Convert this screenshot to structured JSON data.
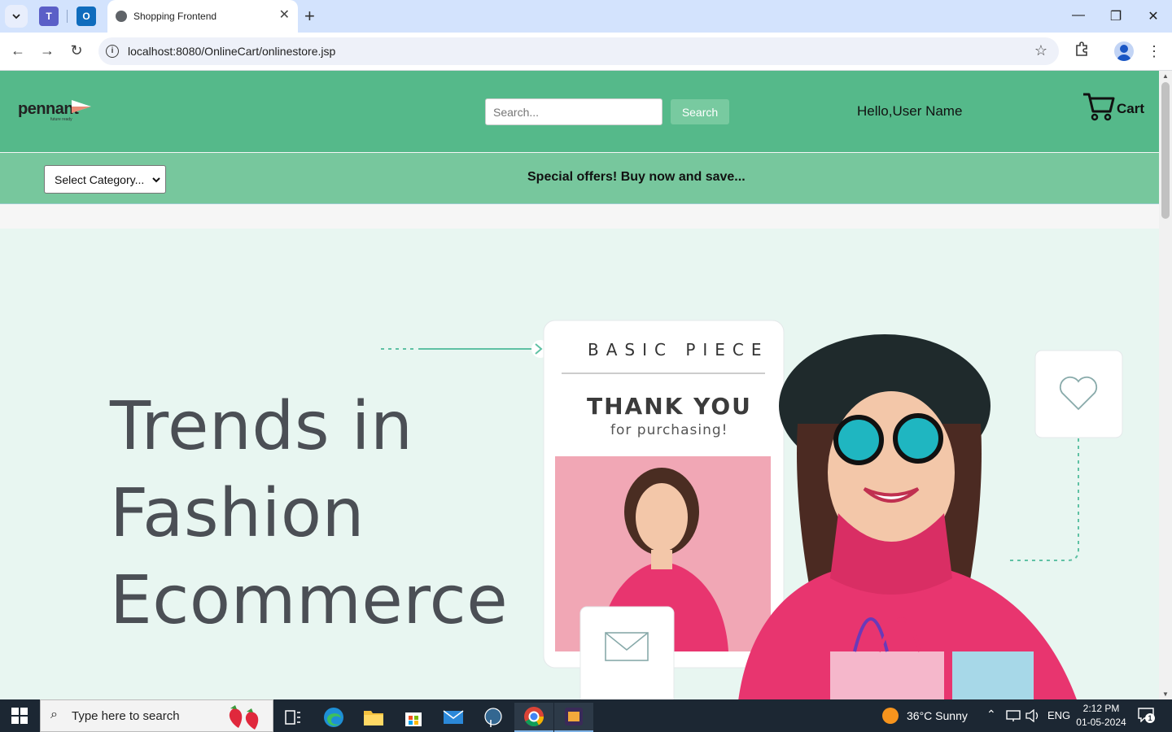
{
  "browser": {
    "tab_title": "Shopping Frontend",
    "url": "localhost:8080/OnlineCart/onlinestore.jsp"
  },
  "header": {
    "logo_text": "pennant",
    "logo_tagline": "future ready",
    "search_placeholder": "Search...",
    "search_button": "Search",
    "greeting": "Hello,User Name",
    "cart_label": "Cart"
  },
  "offer_bar": {
    "category_select": "Select Category...",
    "offer_text": "Special offers! Buy now and save..."
  },
  "hero": {
    "headline_lines": [
      "Trends in",
      "Fashion",
      "Ecommerce"
    ],
    "card_brand": "BASIC PIECE",
    "card_title": "THANK YOU",
    "card_subtitle": "for purchasing!"
  },
  "taskbar": {
    "search_text": "Type here to search",
    "weather": "36°C  Sunny",
    "language": "ENG",
    "time": "2:12 PM",
    "date": "01-05-2024",
    "notification_count": "1"
  },
  "colors": {
    "header_bg": "#55b98a",
    "offer_bg": "#77c79d",
    "hero_bg": "#e8f6f1",
    "accent_pink": "#e8356f"
  }
}
